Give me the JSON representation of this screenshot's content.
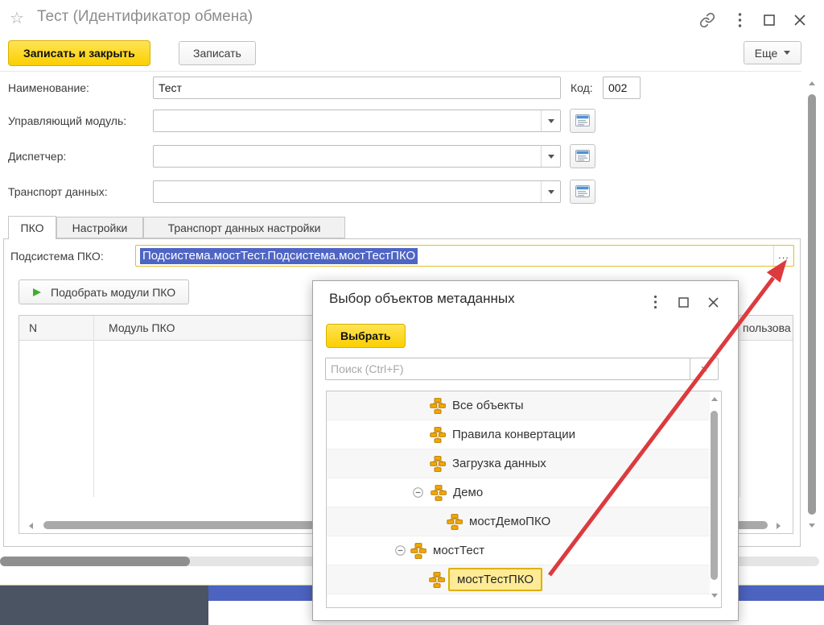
{
  "colors": {
    "accent_yellow": "#fbcf00",
    "accent_yellow_border": "#d8b100",
    "text_selection_bg": "#4e65c4",
    "field_highlight_border": "#e3bd2e",
    "tree_selected_bg": "#ffeb96",
    "tree_selected_border": "#dfb000",
    "arrow_red": "#dc3a3e",
    "icon_orange": "#f0a300",
    "dark_footer": "#4a5462",
    "blue_footer_bar": "#4c63bf"
  },
  "titlebar": {
    "favorite_icon": "☆",
    "title": "Тест (Идентификатор обмена)"
  },
  "toolbar": {
    "save_close": "Записать и закрыть",
    "save": "Записать",
    "more": "Еще"
  },
  "form": {
    "name_label": "Наименование:",
    "name_value": "Тест",
    "code_label": "Код:",
    "code_value": "002",
    "module_label": "Управляющий модуль:",
    "dispatcher_label": "Диспетчер:",
    "transport_label": "Транспорт данных:"
  },
  "tabs": {
    "pko": "ПКО",
    "settings": "Настройки",
    "transport": "Транспорт данных настройки"
  },
  "pko": {
    "subsystem_label": "Подсистема ПКО:",
    "subsystem_value": "Подсистема.мостТест.Подсистема.мостТестПКО",
    "ellipsis": "...",
    "pick_modules": "Подобрать модули ПКО",
    "columns": {
      "n": "N",
      "module": "Модуль ПКО",
      "user": "пользова"
    }
  },
  "modal": {
    "title": "Выбор объектов метаданных",
    "select": "Выбрать",
    "search_placeholder": "Поиск (Ctrl+F)",
    "clear": "×",
    "tree": [
      {
        "label": "Все объекты"
      },
      {
        "label": "Правила конвертации"
      },
      {
        "label": "Загрузка данных"
      },
      {
        "label": "Демо",
        "expanded": true
      },
      {
        "label": "мостДемоПКО"
      },
      {
        "label": "мостТест",
        "expanded": true
      },
      {
        "label": "мостТестПКО",
        "selected": true
      }
    ]
  }
}
